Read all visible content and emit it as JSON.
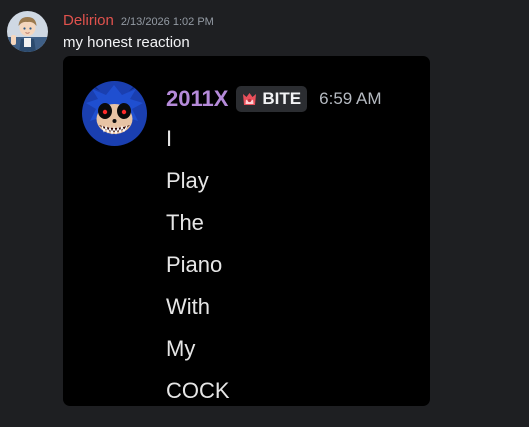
{
  "message": {
    "author": "Delirion",
    "timestamp": "2/13/2026 1:02 PM",
    "content": "my honest reaction",
    "author_color": "#e0524d"
  },
  "embedded_image": {
    "author": "2011X",
    "author_color": "#b58ad9",
    "tag": {
      "icon": "guild-tag-icon",
      "label": "BITE"
    },
    "timestamp": "6:59 AM",
    "lines": [
      "I",
      "Play",
      "The",
      "Piano",
      "With",
      "My",
      "COCK"
    ]
  },
  "icons": {
    "author_avatar": "anime-character-avatar",
    "inner_avatar": "creepy-blue-hedgehog-avatar"
  }
}
